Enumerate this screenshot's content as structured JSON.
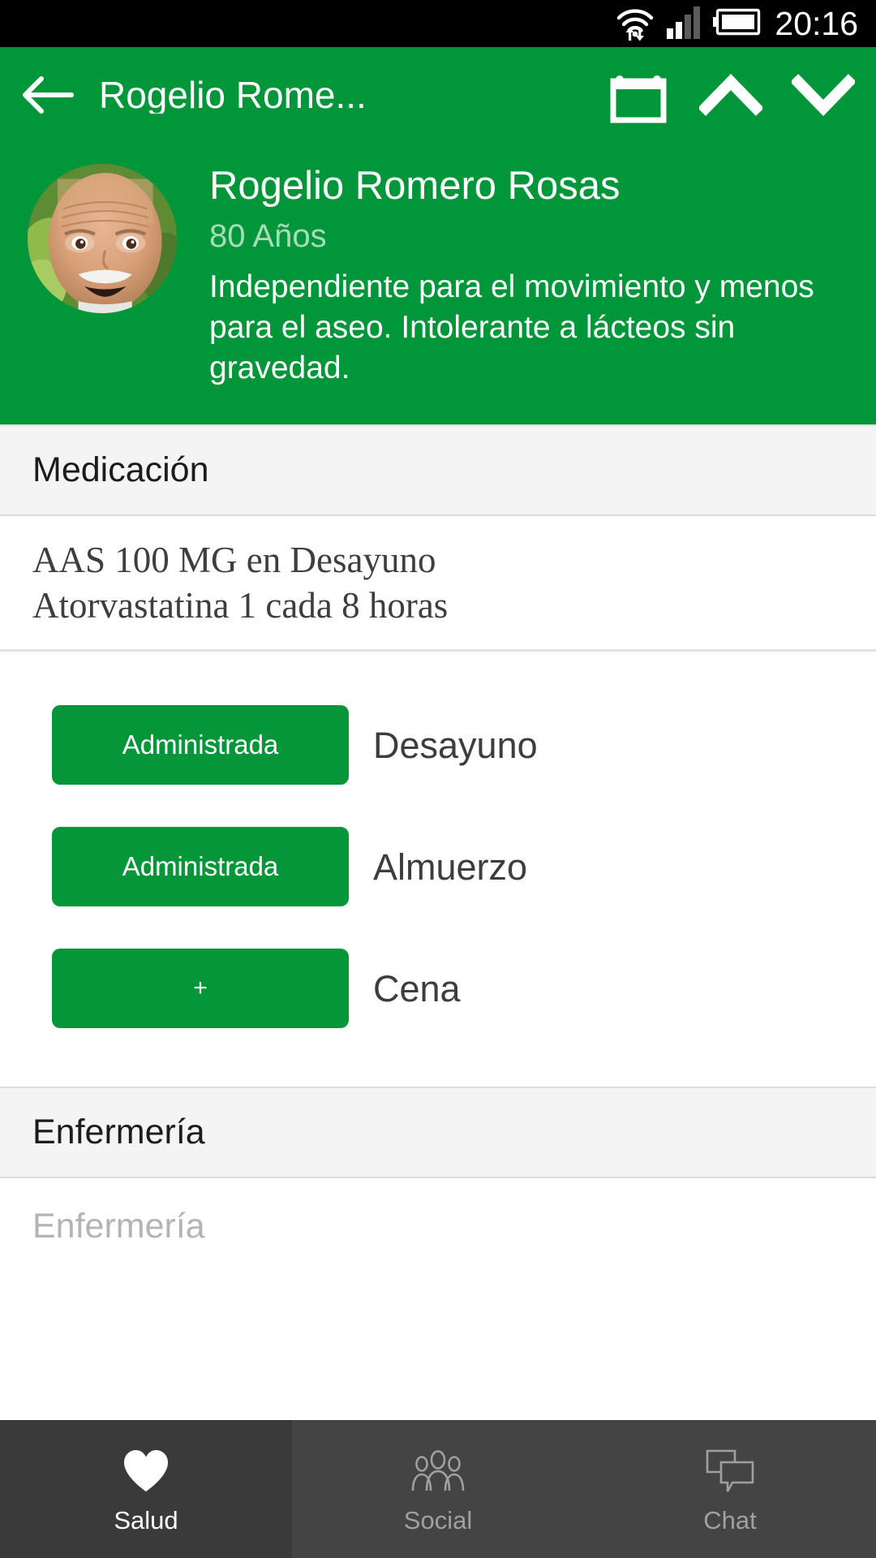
{
  "statusbar": {
    "time": "20:16",
    "icons": [
      "wifi-transfer-icon",
      "cellular-signal-icon",
      "battery-icon"
    ]
  },
  "appbar": {
    "back_icon": "arrow-left-icon",
    "title": "Rogelio Rome...",
    "actions": [
      {
        "name": "calendar-icon",
        "label": "Calendario"
      },
      {
        "name": "chevron-up-icon",
        "label": "Anterior"
      },
      {
        "name": "chevron-down-icon",
        "label": "Siguiente"
      }
    ]
  },
  "profile": {
    "avatar_icon": "patient-photo-avatar",
    "name": "Rogelio Romero Rosas",
    "age": "80 Años",
    "note": "Independiente para el movimiento y menos para el aseo. Intolerante a lácteos sin gravedad."
  },
  "medication": {
    "section_title": "Medicación",
    "lines": [
      "AAS 100 MG en Desayuno",
      "Atorvastatina 1 cada 8 horas"
    ],
    "doses": [
      {
        "button_label": "Administrada",
        "meal": "Desayuno",
        "state": "administered"
      },
      {
        "button_label": "Administrada",
        "meal": "Almuerzo",
        "state": "administered"
      },
      {
        "button_label": "+",
        "meal": "Cena",
        "state": "pending"
      }
    ]
  },
  "nursing": {
    "section_title": "Enfermería",
    "placeholder": "Enfermería",
    "value": ""
  },
  "bottomnav": {
    "items": [
      {
        "label": "Salud",
        "icon": "heart-icon",
        "active": true
      },
      {
        "label": "Social",
        "icon": "people-group-icon",
        "active": false
      },
      {
        "label": "Chat",
        "icon": "chat-bubbles-icon",
        "active": false
      }
    ]
  },
  "colors": {
    "brand_green": "#009639",
    "button_green": "#049639",
    "statusbar_black": "#000000",
    "nav_dark": "#444444",
    "section_gray": "#f4f4f4"
  }
}
